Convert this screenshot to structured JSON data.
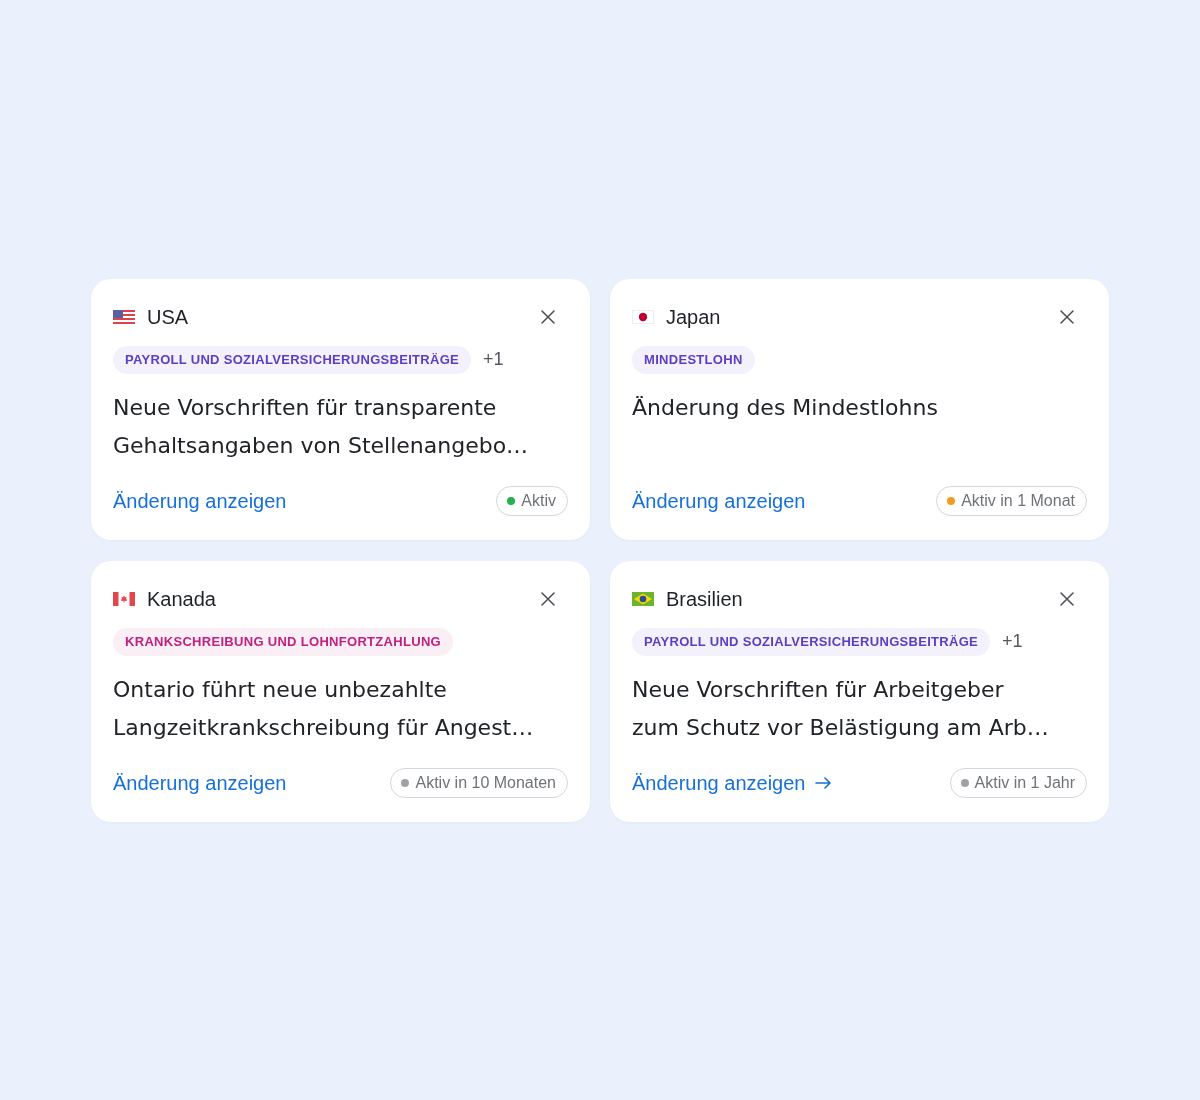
{
  "cards": [
    {
      "country": "USA",
      "flag": {
        "kind": "us"
      },
      "tags": [
        {
          "label": "PAYROLL UND SOZIALVERSICHERUNGSBEITRÄGE",
          "color": "#5b3fc2"
        }
      ],
      "more_tags": "+1",
      "title": "Neue Vorschriften für transparente Gehaltsangaben von Stellenangebo…",
      "link": {
        "label": "Änderung anzeigen",
        "arrow": false
      },
      "status": {
        "label": "Aktiv",
        "color": "#22b14c"
      }
    },
    {
      "country": "Japan",
      "flag": {
        "kind": "jp"
      },
      "tags": [
        {
          "label": "MINDESTLOHN",
          "color": "#5b3fc2"
        }
      ],
      "title": "Änderung des Mindestlohns",
      "link": {
        "label": "Änderung anzeigen",
        "arrow": false
      },
      "status": {
        "label": "Aktiv in 1 Monat",
        "color": "#f29a1f"
      }
    },
    {
      "country": "Kanada",
      "flag": {
        "kind": "ca"
      },
      "tags": [
        {
          "label": "KRANKSCHREIBUNG UND LOHNFORTZAHLUNG",
          "color": "#c0217f"
        }
      ],
      "title": "Ontario führt neue unbezahlte Langzeitkrankschreibung für Angest…",
      "link": {
        "label": "Änderung anzeigen",
        "arrow": false
      },
      "status": {
        "label": "Aktiv in 10 Monaten",
        "color": "#9ea1a6"
      }
    },
    {
      "country": "Brasilien",
      "flag": {
        "kind": "br"
      },
      "tags": [
        {
          "label": "PAYROLL UND SOZIALVERSICHERUNGSBEITRÄGE",
          "color": "#5b3fc2"
        }
      ],
      "more_tags": "+1",
      "title": "Neue Vorschriften für Arbeitgeber zum Schutz vor Belästigung am Arb…",
      "link": {
        "label": "Änderung anzeigen",
        "arrow": true
      },
      "status": {
        "label": "Aktiv in 1 Jahr",
        "color": "#9ea1a6"
      }
    }
  ]
}
